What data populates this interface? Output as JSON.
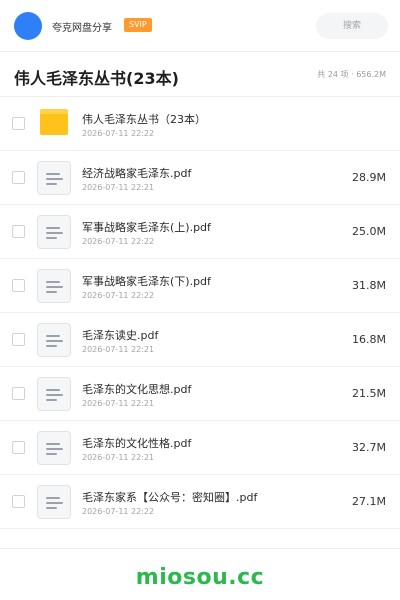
{
  "header": {
    "share_name": "夸克网盘分享",
    "badge": "SVIP",
    "search_label": "搜索"
  },
  "folder": {
    "title": "伟人毛泽东丛书(23本)",
    "meta": "共 24 项 · 656.2M"
  },
  "files": [
    {
      "type": "folder",
      "name": "伟人毛泽东丛书（23本）",
      "date": "2026-07-11 22:22",
      "size": ""
    },
    {
      "type": "pdf",
      "name": "经济战略家毛泽东.pdf",
      "date": "2026-07-11 22:21",
      "size": "28.9M"
    },
    {
      "type": "pdf",
      "name": "军事战略家毛泽东(上).pdf",
      "date": "2026-07-11 22:22",
      "size": "25.0M"
    },
    {
      "type": "pdf",
      "name": "军事战略家毛泽东(下).pdf",
      "date": "2026-07-11 22:22",
      "size": "31.8M"
    },
    {
      "type": "pdf",
      "name": "毛泽东读史.pdf",
      "date": "2026-07-11 22:21",
      "size": "16.8M"
    },
    {
      "type": "pdf",
      "name": "毛泽东的文化思想.pdf",
      "date": "2026-07-11 22:21",
      "size": "21.5M"
    },
    {
      "type": "pdf",
      "name": "毛泽东的文化性格.pdf",
      "date": "2026-07-11 22:21",
      "size": "32.7M"
    },
    {
      "type": "pdf",
      "name": "毛泽东家系【公众号：密知圈】.pdf",
      "date": "2026-07-11 22:22",
      "size": "27.1M"
    }
  ],
  "footer": {
    "watermark": "miosou.cc"
  },
  "colors": {
    "avatar": "#2f80f7",
    "badge": "#ff9a2e",
    "folder_icon": "#ffc21a",
    "watermark": "#2db84d"
  }
}
